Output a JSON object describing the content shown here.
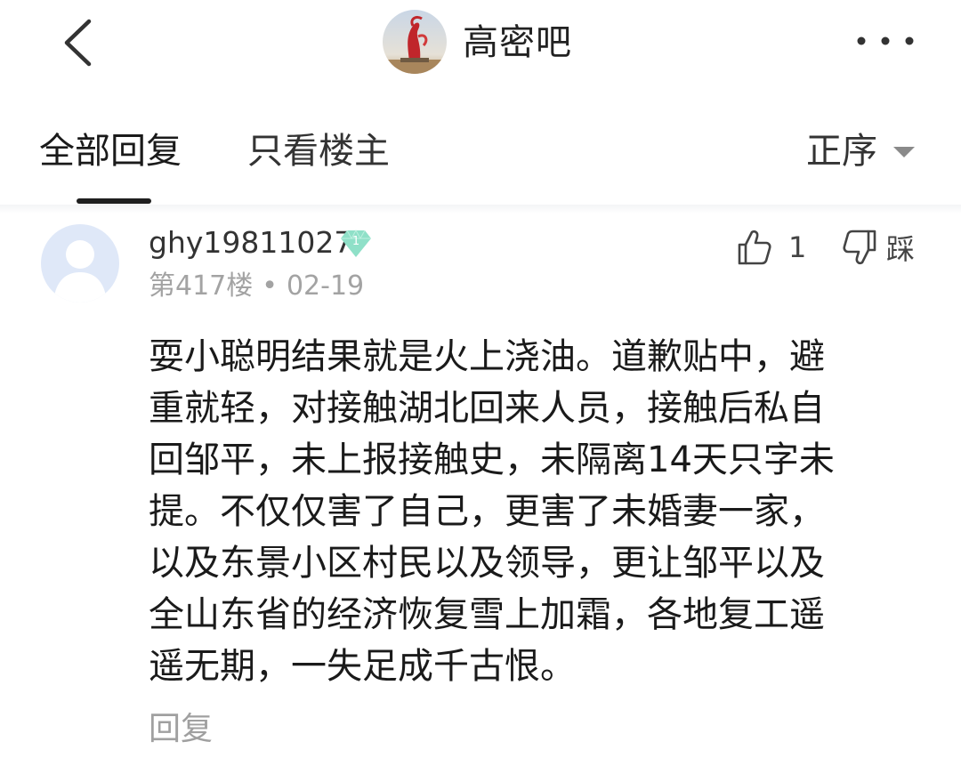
{
  "header": {
    "forum_name": "高密吧",
    "back_icon": "chevron-left-icon",
    "more_icon": "more-dots-icon"
  },
  "tabs": {
    "all_replies": "全部回复",
    "op_only": "只看楼主",
    "sort_label": "正序"
  },
  "post": {
    "username": "ghy19811027",
    "level": "1",
    "floor": "第417楼",
    "separator": "•",
    "date": "02-19",
    "like_count": "1",
    "dislike_label": "踩",
    "content_lines": [
      "耍小聪明结果就是火上浇油。道歉贴中，避",
      "重就轻，对接触湖北回来人员，接触后私自",
      "回邹平，未上报接触史，未隔离14天只字未",
      "提。不仅仅害了自己，更害了未婚妻一家，",
      "以及东景小区村民以及领导，更让邹平以及",
      "全山东省的经济恢复雪上加霜，各地复工遥",
      "遥无期，一失足成千古恨。"
    ],
    "reply_label": "回复"
  },
  "colors": {
    "badge": "#8fe0c8",
    "meta_gray": "#a3a3a3",
    "text": "#1a1a1a",
    "avatar_bg": "#dfe8f8"
  }
}
